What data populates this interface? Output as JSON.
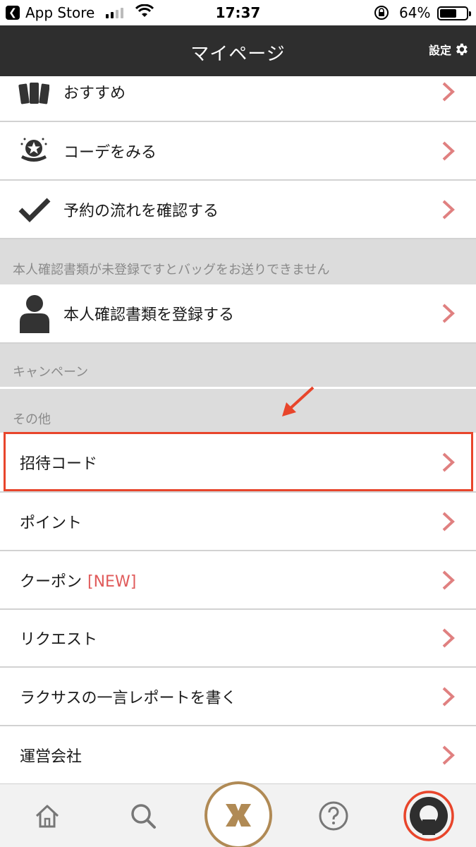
{
  "status_bar": {
    "back_app": "App Store",
    "time": "17:37",
    "battery": "64%"
  },
  "header": {
    "title": "マイページ",
    "settings_label": "設定"
  },
  "menu_top": [
    {
      "label": "おすすめ",
      "icon": "cards-icon"
    },
    {
      "label": "コーデをみる",
      "icon": "star-badge-icon"
    },
    {
      "label": "予約の流れを確認する",
      "icon": "checkmark-icon"
    }
  ],
  "identity_section": {
    "notice": "本人確認書類が未登録ですとバッグをお送りできません",
    "item_label": "本人確認書類を登録する",
    "icon": "person-icon"
  },
  "campaign_section": {
    "title": "キャンペーン"
  },
  "other_section": {
    "title": "その他",
    "items": [
      {
        "label": "招待コード"
      },
      {
        "label": "ポイント"
      },
      {
        "label": "クーポン",
        "badge": "[NEW]"
      },
      {
        "label": "リクエスト"
      },
      {
        "label": "ラクサスの一言レポートを書く"
      },
      {
        "label": "運営会社"
      }
    ]
  },
  "tabbar": {
    "tabs": [
      "home-icon",
      "search-icon",
      "laxus-logo-icon",
      "help-icon",
      "profile-icon"
    ],
    "active": "profile-icon"
  },
  "colors": {
    "header_bg": "#2e2e2e",
    "chevron": "#e08080",
    "highlight": "#e8452b",
    "logo_gold": "#b08a55",
    "new_badge": "#e05a5a"
  }
}
